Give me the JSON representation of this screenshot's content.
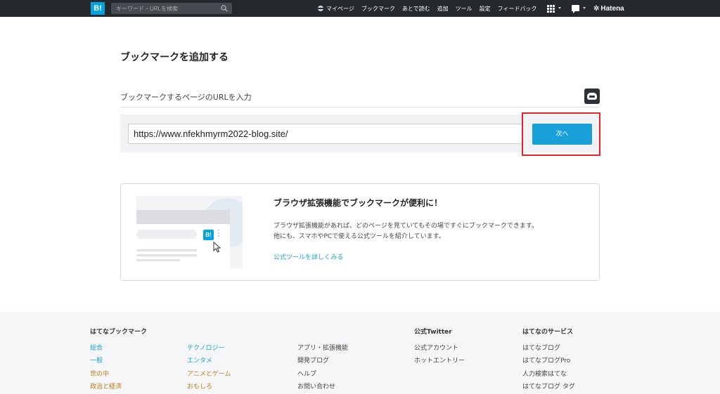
{
  "topbar": {
    "logo": "B!",
    "search_placeholder": "キーワード・URLを検索",
    "nav": [
      "マイページ",
      "ブックマーク",
      "あとで読む",
      "追加",
      "ツール",
      "設定",
      "フィードバック"
    ],
    "brand": "Hatena"
  },
  "main": {
    "title": "ブックマークを追加する",
    "url_label": "ブックマークするページのURLを入力",
    "url_value": "https://www.nfekhmyrm2022-blog.site/",
    "next_label": "次へ"
  },
  "promo": {
    "logo": "B!",
    "title": "ブラウザ拡張機能でブックマークが便利に！",
    "text1": "ブラウザ拡張機能があれば、どのページを見ていてもその場ですぐにブックマークできます。",
    "text2": "他にも、スマホやPCで使える公式ツールを紹介しています。",
    "link": "公式ツールを詳しくみる"
  },
  "footer": {
    "col1_title": "はてなブックマーク",
    "col1": [
      "総合",
      "一般",
      "世の中",
      "政治と経済"
    ],
    "col2": [
      "テクノロジー",
      "エンタメ",
      "アニメとゲーム",
      "おもしろ"
    ],
    "col3": [
      "アプリ・拡張機能",
      "開発ブログ",
      "ヘルプ",
      "お問い合わせ"
    ],
    "col4_title": "公式Twitter",
    "col4": [
      "公式アカウント",
      "ホットエントリー"
    ],
    "col5_title": "はてなのサービス",
    "col5": [
      "はてなブログ",
      "はてなブログPro",
      "人力検索はてな",
      "はてなブログ タグ"
    ]
  },
  "colors": {
    "topbar": "#25292e",
    "accent": "#1aa0d8",
    "highlight": "#e8222a",
    "orange_link": "#c47a1a"
  }
}
